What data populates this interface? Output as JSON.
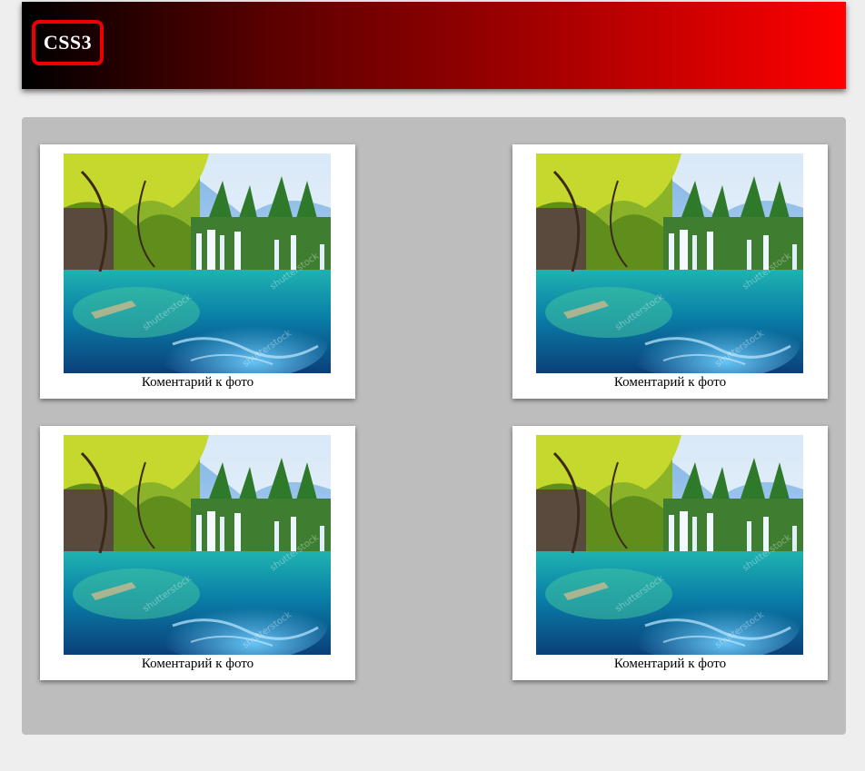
{
  "header": {
    "logo_text": "CSS3"
  },
  "gallery": {
    "items": [
      {
        "image_icon": "waterfall-lake-photo",
        "caption": "Коментарий к фото"
      },
      {
        "image_icon": "waterfall-lake-photo",
        "caption": "Коментарий к фото"
      },
      {
        "image_icon": "waterfall-lake-photo",
        "caption": "Коментарий к фото"
      },
      {
        "image_icon": "waterfall-lake-photo",
        "caption": "Коментарий к фото"
      }
    ]
  },
  "colors": {
    "header_gradient_start": "#000000",
    "header_gradient_end": "#ff0000",
    "logo_border": "#ee0000",
    "panel_background": "#bdbdbd",
    "page_background": "#eeeeee"
  }
}
